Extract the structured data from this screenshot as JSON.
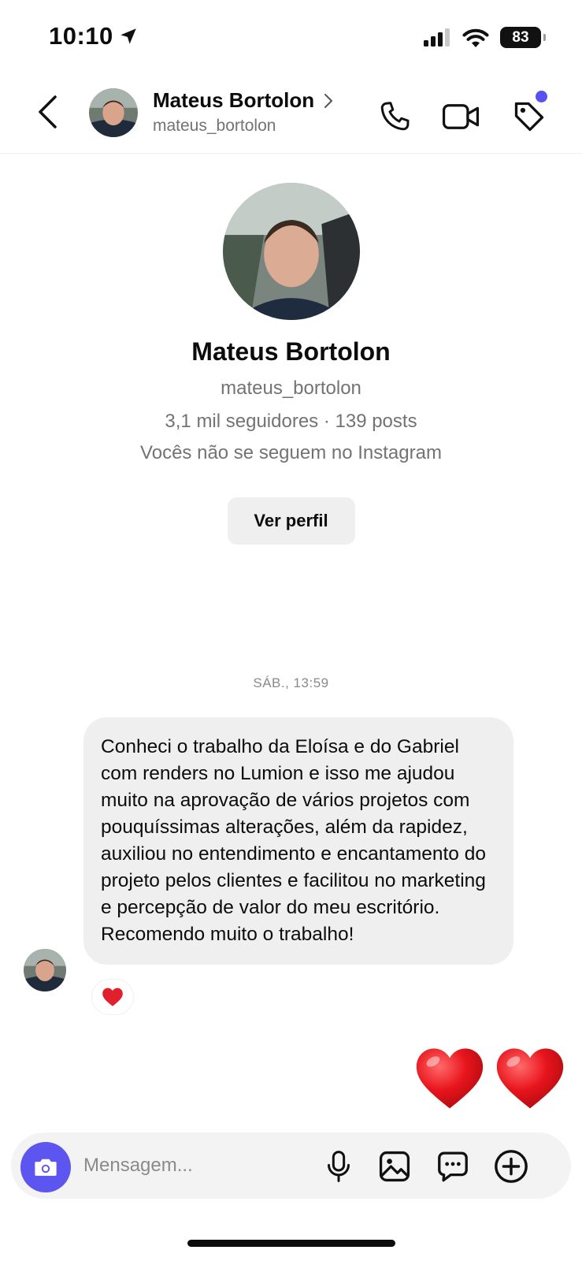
{
  "status_bar": {
    "time": "10:10",
    "battery": "83",
    "icons": [
      "location-arrow-icon",
      "signal-icon",
      "wifi-icon",
      "battery-icon"
    ]
  },
  "header": {
    "contact_name": "Mateus Bortolon",
    "contact_username": "mateus_bortolon",
    "icons": [
      "back-chevron-icon",
      "chevron-right-icon",
      "phone-icon",
      "video-camera-icon",
      "tag-icon"
    ],
    "notification_dot_color": "#5851f2"
  },
  "profile": {
    "name": "Mateus Bortolon",
    "username": "mateus_bortolon",
    "stats": "3,1 mil seguidores · 139 posts",
    "mutual": "Vocês não se seguem no Instagram",
    "view_profile_label": "Ver perfil"
  },
  "conversation": {
    "timestamp": "SÁB., 13:59",
    "message": {
      "text": "Conheci o trabalho da Eloísa e do Gabriel com renders no Lumion e  isso me ajudou muito na aprovação de vários projetos com pouquíssimas alterações, além da rapidez, auxiliou no entendimento e encantamento do projeto pelos clientes e facilitou no marketing e percepção de valor do meu escritório. Recomendo muito o trabalho!",
      "reaction": "heart-icon"
    },
    "sent_reaction": "heart-heart-emoji"
  },
  "composer": {
    "placeholder": "Mensagem...",
    "accent_color": "#5d55f0",
    "icons": [
      "camera-icon",
      "microphone-icon",
      "image-icon",
      "sticker-chat-icon",
      "plus-circle-icon"
    ]
  }
}
